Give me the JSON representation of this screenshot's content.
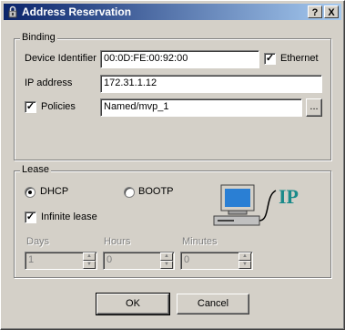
{
  "window": {
    "title": "Address Reservation",
    "help_label": "?",
    "close_label": "X"
  },
  "binding": {
    "group_label": "Binding",
    "device_identifier_label": "Device Identifier",
    "device_identifier_value": "00:0D:FE:00:92:00",
    "ethernet_label": "Ethernet",
    "ethernet_checked": true,
    "ip_address_label": "IP address",
    "ip_address_value": "172.31.1.12",
    "policies_label": "Policies",
    "policies_checked": true,
    "policies_value": "Named/mvp_1",
    "browse_label": "..."
  },
  "lease": {
    "group_label": "Lease",
    "dhcp_label": "DHCP",
    "bootp_label": "BOOTP",
    "selected": "DHCP",
    "infinite_label": "Infinite lease",
    "infinite_checked": true,
    "days_label": "Days",
    "days_value": "1",
    "hours_label": "Hours",
    "hours_value": "0",
    "minutes_label": "Minutes",
    "minutes_value": "0",
    "ip_graphic_text": "IP"
  },
  "footer": {
    "ok_label": "OK",
    "cancel_label": "Cancel"
  },
  "colors": {
    "titlebar_start": "#0a246a",
    "titlebar_end": "#a6caf0",
    "ip_text": "#1a8a8a",
    "monitor_screen": "#2a7fd4"
  }
}
